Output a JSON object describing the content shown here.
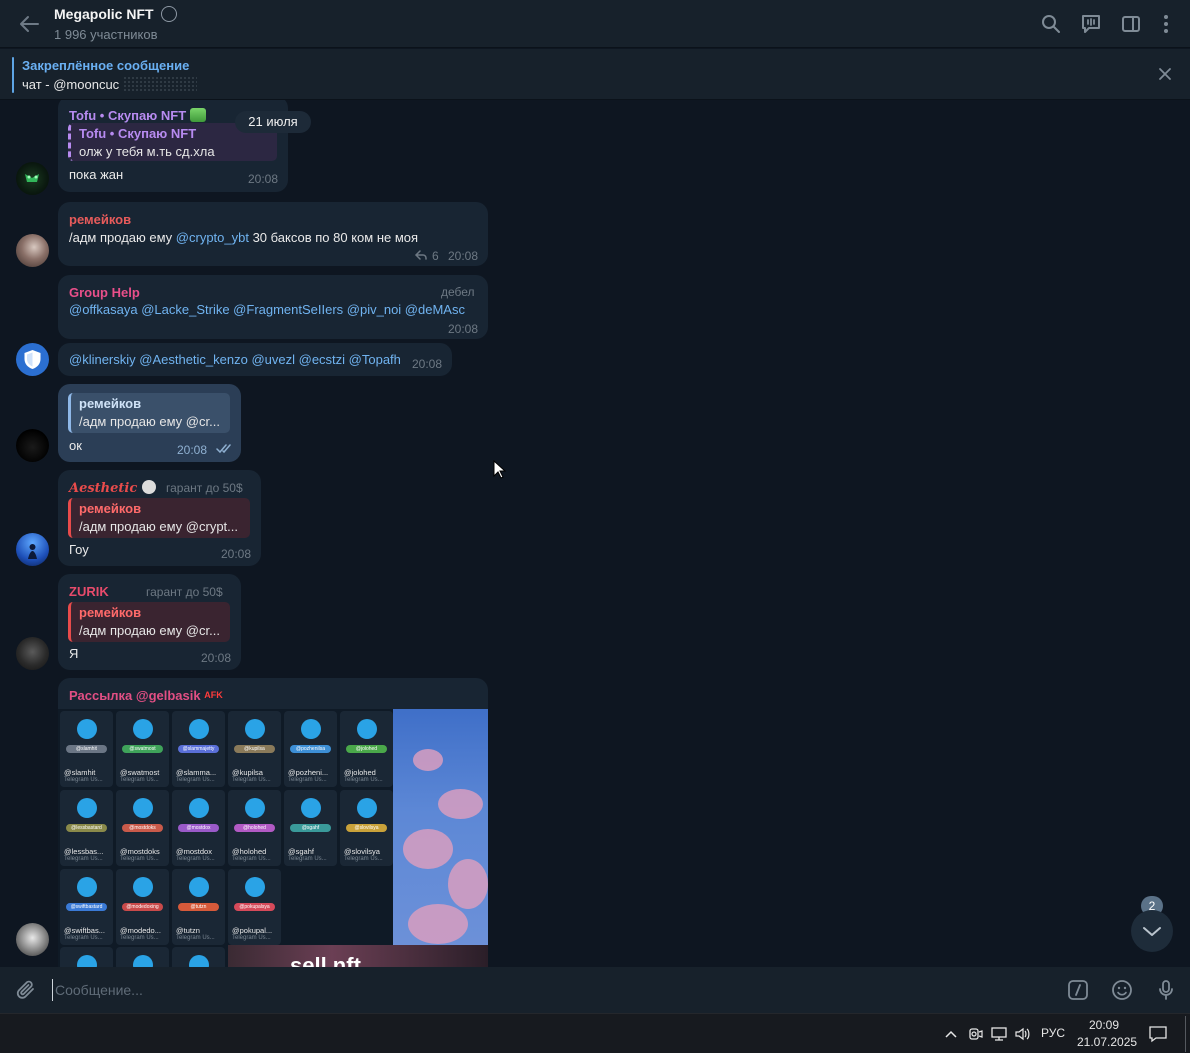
{
  "header": {
    "title": "Megapolic NFT",
    "members": "1 996 участников"
  },
  "pinned": {
    "title": "Закреплённое сообщение",
    "text": "чат - @mooncuc"
  },
  "date_pill": "21 июля",
  "messages": {
    "m1": {
      "sender": "Tofu • Скупаю NFT",
      "quote_name": "Tofu • Скупаю NFT",
      "quote_text": "олж у тебя м.ть сд.хла",
      "text": "пока жан",
      "time": "20:08"
    },
    "m2": {
      "sender": "ремейков",
      "text_prefix": "/адм продаю ему ",
      "mention": "@crypto_ybt",
      "text_suffix": " 30 баксов по 80 ком не моя",
      "replies": "6",
      "time": "20:08"
    },
    "m3": {
      "sender": "Group Help",
      "rank": "дебел",
      "text": "@offkasaya @Lacke_Strike @FragmentSeIIers @piv_noi @deMAsc",
      "time": "20:08"
    },
    "m4": {
      "text": "@klinerskiy @Aesthetic_kenzo @uvezl @ecstzi @Topafh",
      "time": "20:08"
    },
    "m5": {
      "quote_name": "ремейков",
      "quote_text": "/адм продаю ему @cr...",
      "text": "ок",
      "time": "20:08"
    },
    "m6": {
      "sender": "Aesthetic",
      "rank": "гарант до 50$",
      "quote_name": "ремейков",
      "quote_text": "/адм продаю ему @crypt...",
      "text": "Гоу",
      "time": "20:08"
    },
    "m7": {
      "sender": "ZURIK",
      "rank": "гарант до 50$",
      "quote_name": "ремейков",
      "quote_text": "/адм продаю ему @cr...",
      "text": "Я",
      "time": "20:08"
    },
    "m8": {
      "sender": "Рассылка @gelbasik",
      "sender_tag": "AFK"
    }
  },
  "tiles": [
    {
      "tag": "@slamhit",
      "name": "@slamhit",
      "sub": "Telegram Us...",
      "color": "#6b7685"
    },
    {
      "tag": "@swatmost",
      "name": "@swatmost",
      "sub": "Telegram Us...",
      "color": "#3fa35a"
    },
    {
      "tag": "@slammajetty",
      "name": "@slamma...",
      "sub": "Telegram Us...",
      "color": "#5a6fd8"
    },
    {
      "tag": "@kupilsa",
      "name": "@kupilsa",
      "sub": "Telegram Us...",
      "color": "#8a7a5a"
    },
    {
      "tag": "@pozhenilsa",
      "name": "@pozheni...",
      "sub": "Telegram Us...",
      "color": "#3d8fd6"
    },
    {
      "tag": "@jolohed",
      "name": "@jolohed",
      "sub": "Telegram Us...",
      "color": "#4aa84a"
    },
    {
      "tag": "@lessbastard",
      "name": "@lessbas...",
      "sub": "Telegram Us...",
      "color": "#8a8a4a"
    },
    {
      "tag": "@mostdoks",
      "name": "@mostdoks",
      "sub": "Telegram Us...",
      "color": "#c95a4a"
    },
    {
      "tag": "@mostdox",
      "name": "@mostdox",
      "sub": "Telegram Us...",
      "color": "#9a5ac9"
    },
    {
      "tag": "@holohed",
      "name": "@holohed",
      "sub": "Telegram Us...",
      "color": "#b25ac4"
    },
    {
      "tag": "@sgahf",
      "name": "@sgahf",
      "sub": "Telegram Us...",
      "color": "#3a9a9a"
    },
    {
      "tag": "@slovilsya",
      "name": "@slovilsya",
      "sub": "Telegram Us...",
      "color": "#c9a23a"
    },
    {
      "tag": "@swiftbastard",
      "name": "@swiftbas...",
      "sub": "Telegram Us...",
      "color": "#3a7ad6"
    },
    {
      "tag": "@modedoxing",
      "name": "@modedo...",
      "sub": "Telegram Us...",
      "color": "#c94a4a"
    },
    {
      "tag": "@tutzn",
      "name": "@tutzn",
      "sub": "Telegram Us...",
      "color": "#d65a3a"
    },
    {
      "tag": "@pokupalsya",
      "name": "@pokupal...",
      "sub": "Telegram Us...",
      "color": "#d64a5a"
    }
  ],
  "media_overlay_text": "sell nft",
  "scroll_badge": "2",
  "input": {
    "placeholder": "Сообщение..."
  },
  "taskbar": {
    "lang": "РУС",
    "time": "20:09",
    "date": "21.07.2025"
  },
  "colors": {
    "accent": "#5ea5e5",
    "tofu": "#b78bf0",
    "remeikov": "#e85b5b",
    "grouphelp": "#e94f8a",
    "aesthetic": "#e84b4b",
    "zurik": "#e84b6b",
    "rassylka": "#e24f84"
  }
}
